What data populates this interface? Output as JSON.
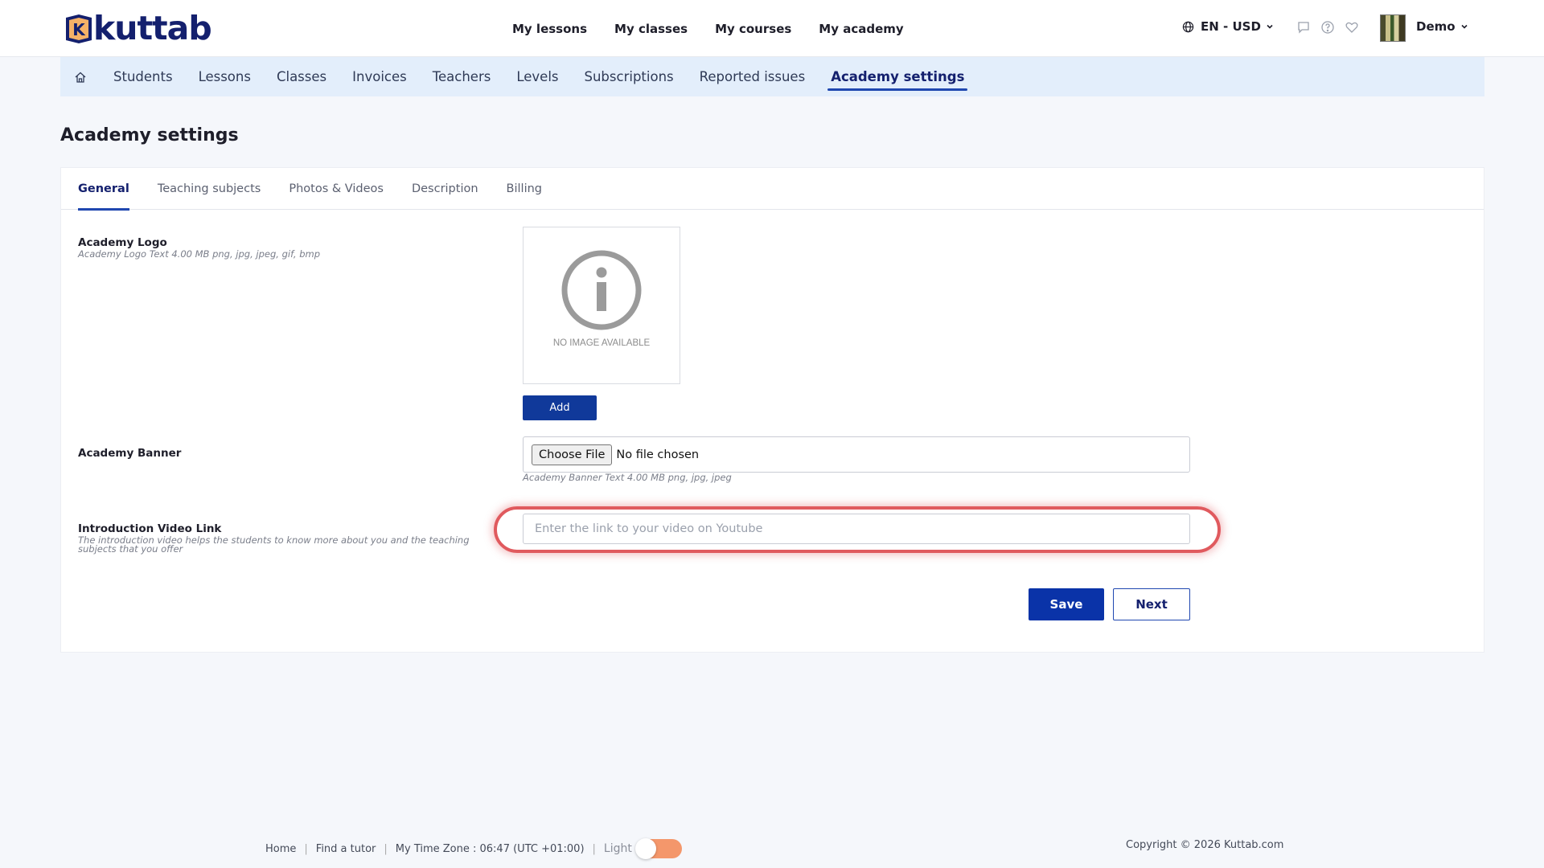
{
  "header": {
    "logo_text": "kuttab",
    "logo_letter": "K",
    "nav": [
      "My lessons",
      "My classes",
      "My courses",
      "My academy"
    ],
    "lang_currency": "EN - USD",
    "user_name": "Demo"
  },
  "subnav": {
    "items": [
      "Students",
      "Lessons",
      "Classes",
      "Invoices",
      "Teachers",
      "Levels",
      "Subscriptions",
      "Reported issues",
      "Academy settings"
    ],
    "active": "Academy settings"
  },
  "page": {
    "title": "Academy settings"
  },
  "tabs": {
    "items": [
      "General",
      "Teaching subjects",
      "Photos & Videos",
      "Description",
      "Billing"
    ],
    "active": "General"
  },
  "form": {
    "logo": {
      "label": "Academy Logo",
      "hint": "Academy Logo Text 4.00 MB png, jpg, jpeg, gif, bmp",
      "placeholder_text": "NO IMAGE AVAILABLE",
      "add_label": "Add"
    },
    "banner": {
      "label": "Academy Banner",
      "choose_label": "Choose File",
      "status": "No file chosen",
      "hint": "Academy Banner Text 4.00 MB png, jpg, jpeg"
    },
    "video": {
      "label": "Introduction Video Link",
      "hint_line1": "The introduction video helps the students to know more about you and the teaching",
      "hint_line2": "subjects that you offer",
      "placeholder": "Enter the link to your video on Youtube",
      "value": ""
    },
    "save_label": "Save",
    "next_label": "Next"
  },
  "footer": {
    "links": [
      "Home",
      "Find a tutor"
    ],
    "timezone": "My Time Zone : 06:47 (UTC +01:00)",
    "theme_label": "Light",
    "copyright": "Copyright © 2026 Kuttab.com"
  },
  "colors": {
    "brand_navy": "#14206e",
    "primary_button": "#0a33a8",
    "highlight_ring": "#e05a5e",
    "toggle": "#f4976b",
    "subnav_bg": "#e3eefb"
  }
}
